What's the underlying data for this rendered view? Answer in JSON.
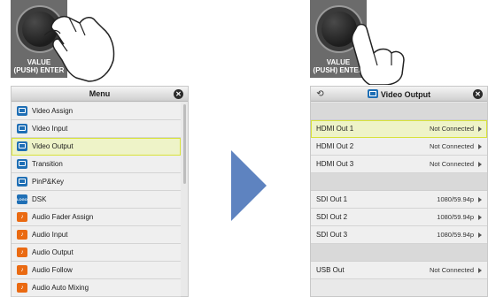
{
  "knob": {
    "label_line1": "VALUE",
    "label_line2": "(PUSH) ENTER"
  },
  "menu_screen": {
    "title": "Menu",
    "items": [
      {
        "label": "Video Assign",
        "icon": "video-assign-icon",
        "color": "blue"
      },
      {
        "label": "Video Input",
        "icon": "video-input-icon",
        "color": "blue"
      },
      {
        "label": "Video Output",
        "icon": "video-output-icon",
        "color": "blue",
        "selected": true
      },
      {
        "label": "Transition",
        "icon": "transition-icon",
        "color": "blue"
      },
      {
        "label": "PinP&Key",
        "icon": "pinp-key-icon",
        "color": "blue"
      },
      {
        "label": "DSK",
        "icon": "logo-icon",
        "color": "logo"
      },
      {
        "label": "Audio Fader Assign",
        "icon": "audio-fader-icon",
        "color": "orange"
      },
      {
        "label": "Audio Input",
        "icon": "audio-input-icon",
        "color": "orange"
      },
      {
        "label": "Audio Output",
        "icon": "audio-output-icon",
        "color": "orange"
      },
      {
        "label": "Audio Follow",
        "icon": "audio-follow-icon",
        "color": "orange"
      },
      {
        "label": "Audio Auto Mixing",
        "icon": "audio-auto-mixing-icon",
        "color": "orange"
      }
    ]
  },
  "output_screen": {
    "title": "Video Output",
    "groups": [
      [
        {
          "name": "HDMI Out 1",
          "value": "Not Connected",
          "selected": true
        },
        {
          "name": "HDMI Out 2",
          "value": "Not Connected"
        },
        {
          "name": "HDMI Out 3",
          "value": "Not Connected"
        }
      ],
      [
        {
          "name": "SDI Out 1",
          "value": "1080/59.94p"
        },
        {
          "name": "SDI Out 2",
          "value": "1080/59.94p"
        },
        {
          "name": "SDI Out 3",
          "value": "1080/59.94p"
        }
      ],
      [
        {
          "name": "USB Out",
          "value": "Not Connected"
        }
      ]
    ]
  },
  "colors": {
    "accent_blue": "#1f6fb5",
    "audio_orange": "#ea6a12",
    "selection_outline": "#d8e23a",
    "arrow": "#5e83c0"
  }
}
